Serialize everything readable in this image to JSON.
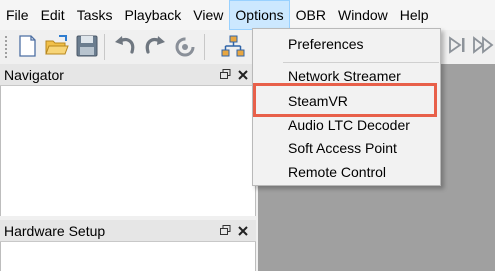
{
  "menubar": {
    "items": [
      "File",
      "Edit",
      "Tasks",
      "Playback",
      "View",
      "Options",
      "OBR",
      "Window",
      "Help"
    ],
    "active_index": 5
  },
  "toolbar": {
    "buttons": [
      "new-file-icon",
      "open-folder-icon",
      "save-icon",
      "undo-icon",
      "redo-icon",
      "reset-icon",
      "network-icon"
    ]
  },
  "panels": {
    "navigator": {
      "title": "Navigator"
    },
    "hardware": {
      "title": "Hardware Setup"
    }
  },
  "options_menu": {
    "items": [
      {
        "label": "Preferences"
      },
      {
        "label": "Network Streamer"
      },
      {
        "label": "SteamVR",
        "highlighted": true
      },
      {
        "label": "Audio LTC Decoder"
      },
      {
        "label": "Soft Access Point"
      },
      {
        "label": "Remote Control"
      }
    ]
  },
  "colors": {
    "active_menu_bg": "#cce8ff",
    "highlight_border": "#e8604a",
    "workspace_gray": "#a0a0a0"
  }
}
